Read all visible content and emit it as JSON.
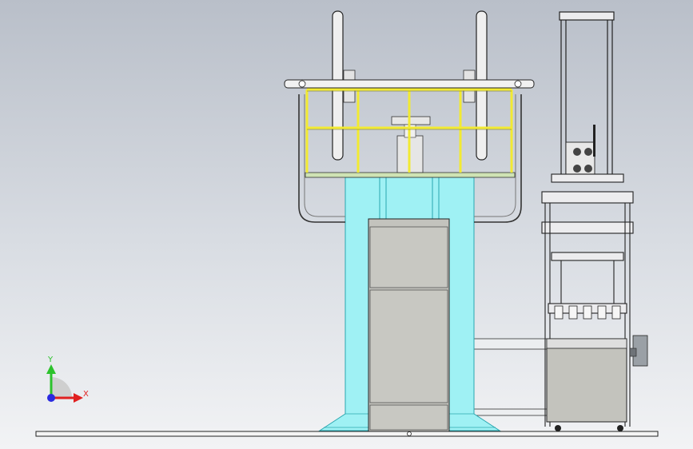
{
  "view": {
    "background_top": "#b9bfc9",
    "background_bottom": "#f2f3f5"
  },
  "colors": {
    "column": "#9ff1f4",
    "column_edge": "#2aa7b0",
    "railing": "#f2ea32",
    "cabinet": "#c3c3bd",
    "frame": "#e9eaec",
    "deck": "#cfe3b4",
    "line": "#1a1a1a"
  },
  "triad": {
    "x_label": "X",
    "y_label": "Y",
    "x_color": "#e02020",
    "y_color": "#2cc22c",
    "origin_color": "#2a2ae0"
  }
}
